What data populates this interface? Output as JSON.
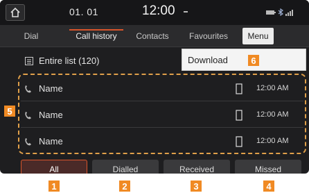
{
  "status": {
    "date": "01. 01",
    "time": "12:00"
  },
  "tabs": [
    {
      "label": "Dial",
      "active": false
    },
    {
      "label": "Call history",
      "active": true
    },
    {
      "label": "Contacts",
      "active": false
    },
    {
      "label": "Favourites",
      "active": false
    }
  ],
  "menu_label": "Menu",
  "entire_list": "Entire list (120)",
  "dropdown": {
    "item": "Download"
  },
  "rows": [
    {
      "name": "Name",
      "time": "12:00 AM"
    },
    {
      "name": "Name",
      "time": "12:00 AM"
    },
    {
      "name": "Name",
      "time": "12:00 AM"
    }
  ],
  "buttons": [
    {
      "label": "All",
      "active": true
    },
    {
      "label": "Dialled",
      "active": false
    },
    {
      "label": "Received",
      "active": false
    },
    {
      "label": "Missed",
      "active": false
    }
  ],
  "badges": [
    "1",
    "2",
    "3",
    "4",
    "5",
    "6"
  ],
  "colors": {
    "accent": "#d9552b",
    "badge": "#f08a24",
    "highlight_border": "#e0a04a"
  }
}
